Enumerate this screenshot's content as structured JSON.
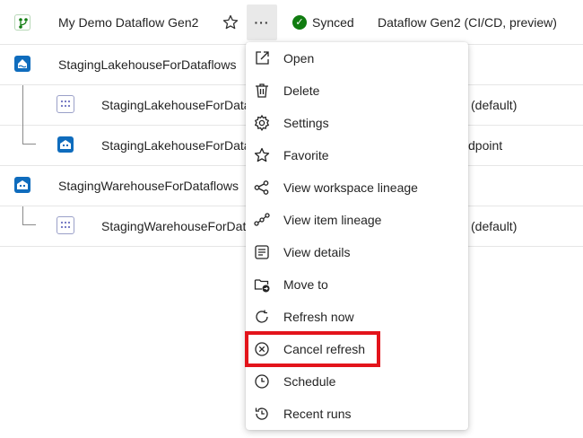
{
  "rows": [
    {
      "name": "My Demo Dataflow Gen2",
      "status": "Synced",
      "type": "Dataflow Gen2 (CI/CD, preview)"
    },
    {
      "name": "StagingLakehouseForDataflows"
    },
    {
      "name": "StagingLakehouseForDataflows_…",
      "extra": "(default)"
    },
    {
      "name": "StagingLakehouseForDataflows_…",
      "extra": "dpoint"
    },
    {
      "name": "StagingWarehouseForDataflows"
    },
    {
      "name": "StagingWarehouseForDataflows_…",
      "extra": "(default)"
    }
  ],
  "menu": {
    "items": [
      {
        "label": "Open",
        "icon": "open-in-new-icon"
      },
      {
        "label": "Delete",
        "icon": "delete-icon"
      },
      {
        "label": "Settings",
        "icon": "settings-icon"
      },
      {
        "label": "Favorite",
        "icon": "star-icon"
      },
      {
        "label": "View workspace lineage",
        "icon": "workspace-lineage-icon"
      },
      {
        "label": "View item lineage",
        "icon": "item-lineage-icon"
      },
      {
        "label": "View details",
        "icon": "details-icon"
      },
      {
        "label": "Move to",
        "icon": "move-to-folder-icon"
      },
      {
        "label": "Refresh now",
        "icon": "refresh-icon"
      },
      {
        "label": "Cancel refresh",
        "icon": "cancel-icon"
      },
      {
        "label": "Schedule",
        "icon": "clock-icon"
      },
      {
        "label": "Recent runs",
        "icon": "history-icon"
      }
    ]
  },
  "more_label": "···",
  "colors": {
    "accent": "#0f6cbd",
    "synced": "#107c10",
    "highlight": "#e3141b",
    "dataflow": "#107c10"
  }
}
